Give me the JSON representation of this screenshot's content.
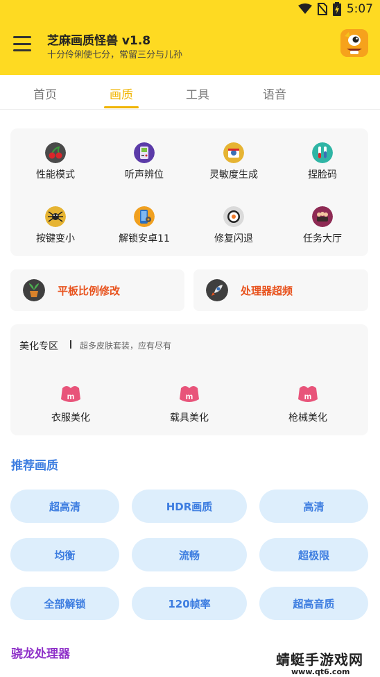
{
  "status_bar": {
    "time": "5:07"
  },
  "app_bar": {
    "title": "芝麻画质怪兽 v1.8",
    "subtitle": "十分伶俐使七分，常留三分与儿孙"
  },
  "tabs": [
    {
      "label": "首页",
      "active": false
    },
    {
      "label": "画质",
      "active": true
    },
    {
      "label": "工具",
      "active": false
    },
    {
      "label": "语音",
      "active": false
    }
  ],
  "tool_grid": [
    {
      "label": "性能模式",
      "icon": "cherry-icon"
    },
    {
      "label": "听声辨位",
      "icon": "gameboy-icon"
    },
    {
      "label": "灵敏度生成",
      "icon": "camera-icon"
    },
    {
      "label": "捏脸码",
      "icon": "tubes-icon"
    },
    {
      "label": "按键变小",
      "icon": "spider-icon"
    },
    {
      "label": "解锁安卓11",
      "icon": "phone-gear-icon"
    },
    {
      "label": "修复闪退",
      "icon": "sushi-icon"
    },
    {
      "label": "任务大厅",
      "icon": "team-icon"
    }
  ],
  "promos": [
    {
      "label": "平板比例修改",
      "icon": "plant-icon"
    },
    {
      "label": "处理器超频",
      "icon": "rocket-icon"
    }
  ],
  "beauty": {
    "title": "美化专区",
    "subtitle": "超多皮肤套装，应有尽有",
    "items": [
      {
        "label": "衣服美化"
      },
      {
        "label": "载具美化"
      },
      {
        "label": "枪械美化"
      }
    ]
  },
  "recommended": {
    "title": "推荐画质",
    "options": [
      "超高清",
      "HDR画质",
      "高清",
      "均衡",
      "流畅",
      "超极限",
      "全部解锁",
      "120帧率",
      "超高音质"
    ]
  },
  "snapdragon": {
    "title": "骁龙处理器"
  },
  "watermark": {
    "text": "蜻蜓手游戏网",
    "url": "www.qt6.com"
  },
  "colors": {
    "accent_yellow": "#FEDA22",
    "tab_active": "#F0B400",
    "promo_text": "#E8531E",
    "section_blue": "#3D7DE0",
    "section_purple": "#8E2FC8",
    "pill_bg": "#DDEEFC"
  }
}
